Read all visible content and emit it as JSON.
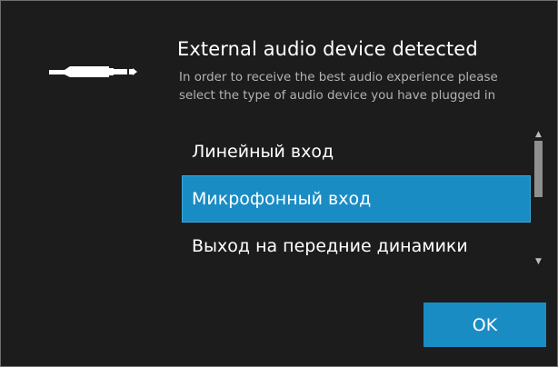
{
  "dialog": {
    "icon": "audio-jack-icon",
    "title": "External audio device detected",
    "description": "In order to receive the best audio experience please select the type of audio device you have plugged in"
  },
  "device_list": {
    "items": [
      {
        "label": "Линейный вход",
        "selected": false
      },
      {
        "label": "Микрофонный вход",
        "selected": true
      },
      {
        "label": "Выход на передние динамики",
        "selected": false
      }
    ]
  },
  "scrollbar": {
    "up_icon": "▲",
    "down_icon": "▼"
  },
  "buttons": {
    "ok_label": "OK"
  },
  "colors": {
    "background": "#1c1c1c",
    "accent": "#1a8cc4",
    "text": "#ffffff",
    "secondary_text": "#b3b3b3"
  }
}
